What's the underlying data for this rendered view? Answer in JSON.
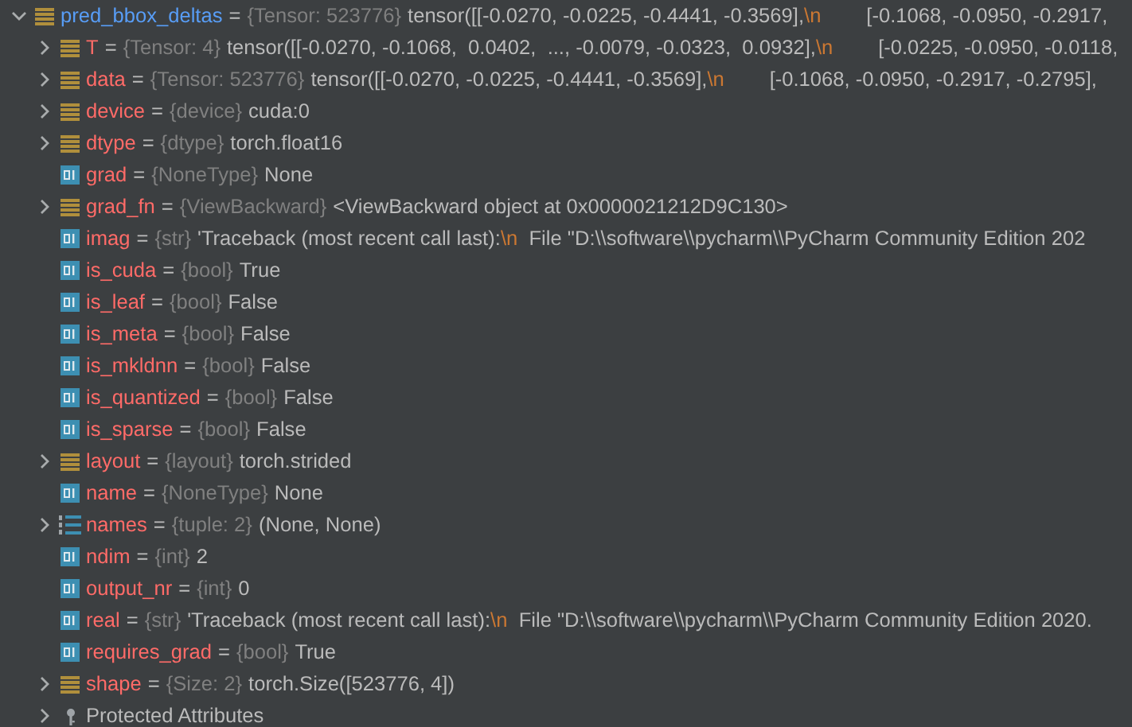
{
  "separator": "=",
  "tree": {
    "name": "pred_bbox_deltas",
    "type": "{Tensor: 523776}",
    "kind": "list",
    "expanded": true,
    "value": [
      {
        "text": "tensor([[-0.0270, -0.0225, -0.4441, -0.3569],",
        "kind": "plain"
      },
      {
        "text": "\\n",
        "kind": "escape"
      },
      {
        "text": "        [-0.1068, -0.0950, -0.2917,",
        "kind": "plain"
      }
    ],
    "children": [
      {
        "name": "T",
        "type": "{Tensor: 4}",
        "kind": "list",
        "expanded": false,
        "value": [
          {
            "text": "tensor([[-0.0270, -0.1068,  0.0402,  ..., -0.0079, -0.0323,  0.0932],",
            "kind": "plain"
          },
          {
            "text": "\\n",
            "kind": "escape"
          },
          {
            "text": "        [-0.0225, -0.0950, -0.0118,",
            "kind": "plain"
          }
        ]
      },
      {
        "name": "data",
        "type": "{Tensor: 523776}",
        "kind": "list",
        "expanded": false,
        "value": [
          {
            "text": "tensor([[-0.0270, -0.0225, -0.4441, -0.3569],",
            "kind": "plain"
          },
          {
            "text": "\\n",
            "kind": "escape"
          },
          {
            "text": "        [-0.1068, -0.0950, -0.2917, -0.2795],",
            "kind": "plain"
          }
        ]
      },
      {
        "name": "device",
        "type": "{device}",
        "kind": "list",
        "expanded": false,
        "value": [
          {
            "text": "cuda:0",
            "kind": "plain"
          }
        ]
      },
      {
        "name": "dtype",
        "type": "{dtype}",
        "kind": "list",
        "expanded": false,
        "value": [
          {
            "text": "torch.float16",
            "kind": "plain"
          }
        ]
      },
      {
        "name": "grad",
        "type": "{NoneType}",
        "kind": "primitive",
        "value": [
          {
            "text": "None",
            "kind": "plain"
          }
        ]
      },
      {
        "name": "grad_fn",
        "type": "{ViewBackward}",
        "kind": "list",
        "expanded": false,
        "value": [
          {
            "text": "<ViewBackward object at 0x0000021212D9C130>",
            "kind": "plain"
          }
        ]
      },
      {
        "name": "imag",
        "type": "{str}",
        "kind": "primitive",
        "value": [
          {
            "text": "'Traceback (most recent call last):",
            "kind": "plain"
          },
          {
            "text": "\\n",
            "kind": "escape"
          },
          {
            "text": "  File \"D:\\\\software\\\\pycharm\\\\PyCharm Community Edition 202",
            "kind": "plain"
          }
        ]
      },
      {
        "name": "is_cuda",
        "type": "{bool}",
        "kind": "primitive",
        "value": [
          {
            "text": "True",
            "kind": "plain"
          }
        ]
      },
      {
        "name": "is_leaf",
        "type": "{bool}",
        "kind": "primitive",
        "value": [
          {
            "text": "False",
            "kind": "plain"
          }
        ]
      },
      {
        "name": "is_meta",
        "type": "{bool}",
        "kind": "primitive",
        "value": [
          {
            "text": "False",
            "kind": "plain"
          }
        ]
      },
      {
        "name": "is_mkldnn",
        "type": "{bool}",
        "kind": "primitive",
        "value": [
          {
            "text": "False",
            "kind": "plain"
          }
        ]
      },
      {
        "name": "is_quantized",
        "type": "{bool}",
        "kind": "primitive",
        "value": [
          {
            "text": "False",
            "kind": "plain"
          }
        ]
      },
      {
        "name": "is_sparse",
        "type": "{bool}",
        "kind": "primitive",
        "value": [
          {
            "text": "False",
            "kind": "plain"
          }
        ]
      },
      {
        "name": "layout",
        "type": "{layout}",
        "kind": "list",
        "expanded": false,
        "value": [
          {
            "text": "torch.strided",
            "kind": "plain"
          }
        ]
      },
      {
        "name": "name",
        "type": "{NoneType}",
        "kind": "primitive",
        "value": [
          {
            "text": "None",
            "kind": "plain"
          }
        ]
      },
      {
        "name": "names",
        "type": "{tuple: 2}",
        "kind": "tuple",
        "expanded": false,
        "value": [
          {
            "text": "(None, None)",
            "kind": "plain"
          }
        ]
      },
      {
        "name": "ndim",
        "type": "{int}",
        "kind": "primitive",
        "value": [
          {
            "text": "2",
            "kind": "plain"
          }
        ]
      },
      {
        "name": "output_nr",
        "type": "{int}",
        "kind": "primitive",
        "value": [
          {
            "text": "0",
            "kind": "plain"
          }
        ]
      },
      {
        "name": "real",
        "type": "{str}",
        "kind": "primitive",
        "value": [
          {
            "text": "'Traceback (most recent call last):",
            "kind": "plain"
          },
          {
            "text": "\\n",
            "kind": "escape"
          },
          {
            "text": "  File \"D:\\\\software\\\\pycharm\\\\PyCharm Community Edition 2020.",
            "kind": "plain"
          }
        ]
      },
      {
        "name": "requires_grad",
        "type": "{bool}",
        "kind": "primitive",
        "value": [
          {
            "text": "True",
            "kind": "plain"
          }
        ]
      },
      {
        "name": "shape",
        "type": "{Size: 2}",
        "kind": "list",
        "expanded": false,
        "value": [
          {
            "text": "torch.Size([523776, 4])",
            "kind": "plain"
          }
        ]
      },
      {
        "name": "Protected Attributes",
        "kind": "protected",
        "expanded": false
      }
    ]
  }
}
